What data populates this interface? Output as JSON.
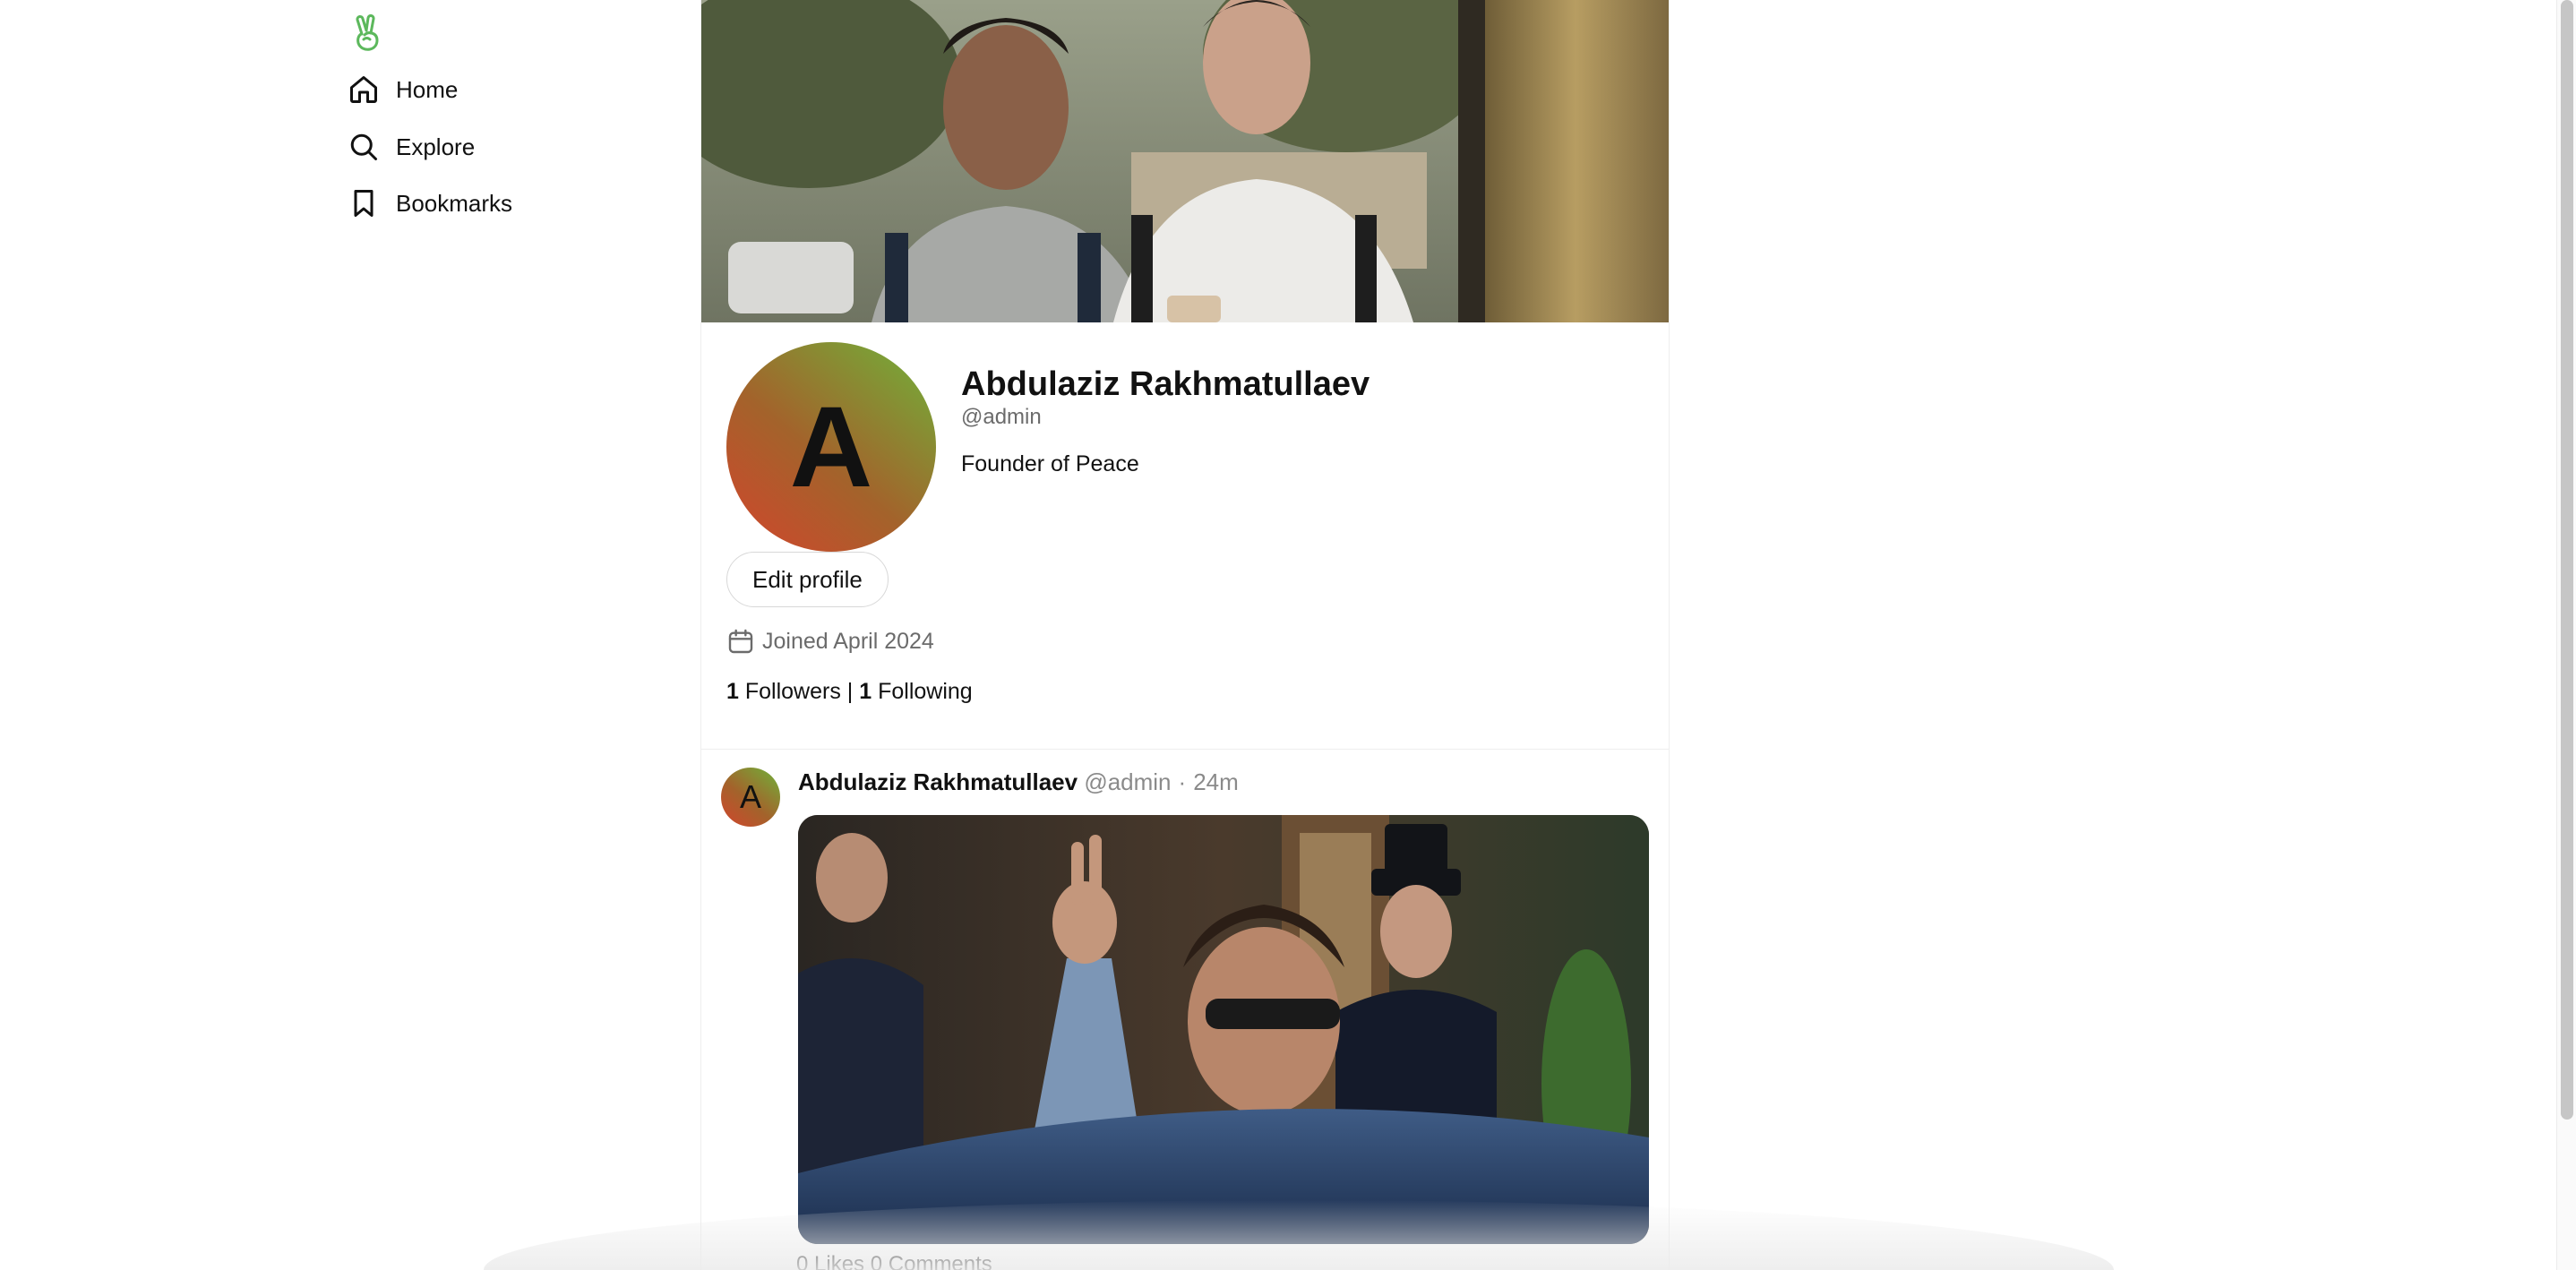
{
  "sidebar": {
    "logo_icon": "peace-hand-icon",
    "accent": "#5cb85c",
    "items": [
      {
        "label": "Home",
        "icon": "home-icon"
      },
      {
        "label": "Explore",
        "icon": "search-icon"
      },
      {
        "label": "Bookmarks",
        "icon": "bookmark-icon"
      }
    ]
  },
  "profile": {
    "avatar_letter": "A",
    "name": "Abdulaziz Rakhmatullaev",
    "handle": "@admin",
    "bio": "Founder of Peace",
    "edit_label": "Edit profile",
    "joined": "Joined April 2024",
    "followers_count": "1",
    "followers_label": "Followers",
    "separator": "|",
    "following_count": "1",
    "following_label": "Following"
  },
  "post": {
    "avatar_letter": "A",
    "author": "Abdulaziz Rakhmatullaev",
    "handle": "@admin",
    "dot": "·",
    "time": "24m",
    "likes_count": "0",
    "likes_label": "Likes",
    "comments_count": "0",
    "comments_label": "Comments"
  }
}
